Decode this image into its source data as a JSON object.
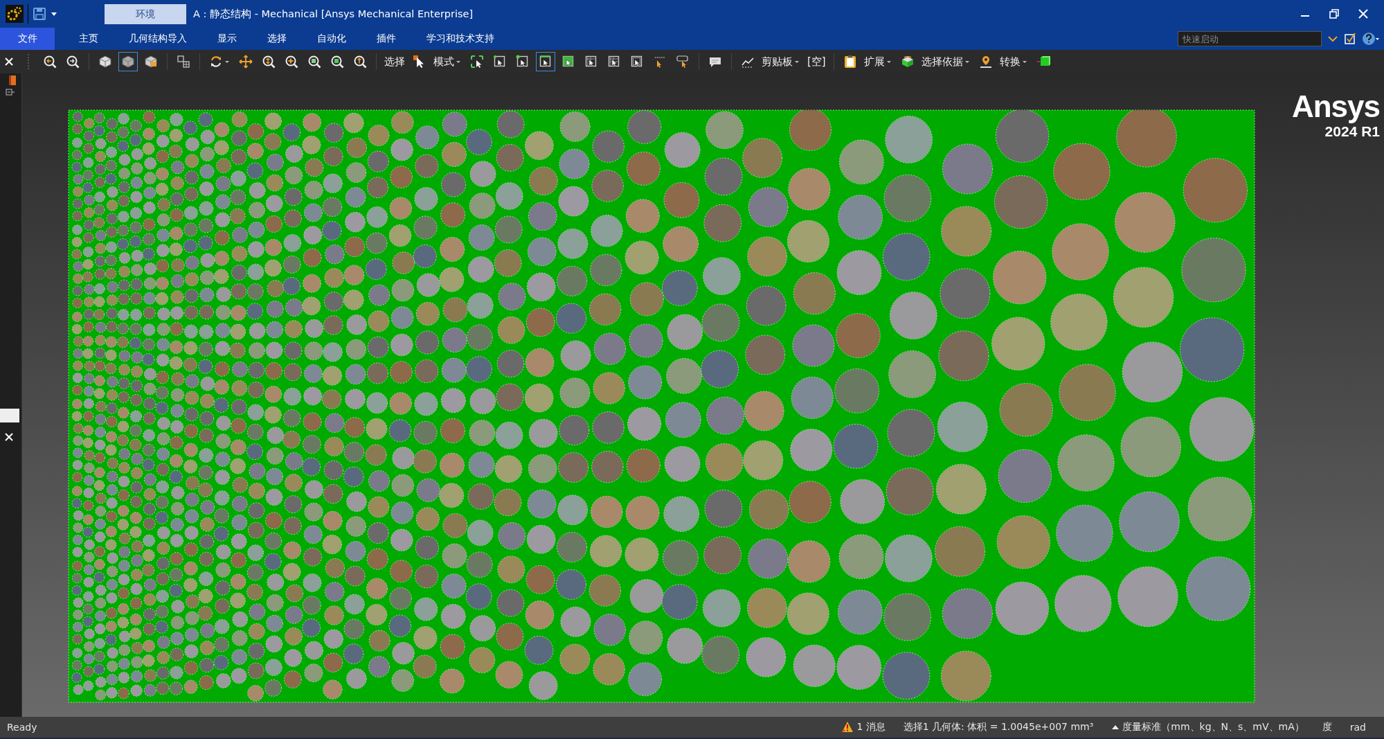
{
  "window": {
    "tab": "环境",
    "title": "A : 静态结构 - Mechanical [Ansys Mechanical Enterprise]"
  },
  "menu": [
    {
      "label": "文件",
      "selected": true
    },
    {
      "label": "主页",
      "selected": false
    },
    {
      "label": "几何结构导入",
      "selected": false
    },
    {
      "label": "显示",
      "selected": false
    },
    {
      "label": "选择",
      "selected": false
    },
    {
      "label": "自动化",
      "selected": false
    },
    {
      "label": "插件",
      "selected": false
    },
    {
      "label": "学习和技术支持",
      "selected": false
    }
  ],
  "quick_launch": {
    "placeholder": "快速启动"
  },
  "toolbar": [
    {
      "kind": "icon",
      "selected": false
    },
    {
      "kind": "icon",
      "selected": false
    },
    {
      "kind": "separator"
    },
    {
      "kind": "icon",
      "selected": false
    },
    {
      "kind": "icon",
      "selected": true
    },
    {
      "kind": "icon",
      "selected": false
    },
    {
      "kind": "separator"
    },
    {
      "kind": "icon",
      "selected": false
    },
    {
      "kind": "separator"
    },
    {
      "kind": "icon",
      "selected": false,
      "dropdown": true
    },
    {
      "kind": "icon",
      "selected": false
    },
    {
      "kind": "icon",
      "selected": false
    },
    {
      "kind": "icon",
      "selected": false
    },
    {
      "kind": "icon",
      "selected": false
    },
    {
      "kind": "icon",
      "selected": false
    },
    {
      "kind": "icon",
      "selected": false
    },
    {
      "kind": "separator"
    },
    {
      "kind": "text",
      "label": "选择"
    },
    {
      "kind": "icon",
      "selected": false
    },
    {
      "kind": "menu",
      "label": "模式"
    },
    {
      "kind": "icon",
      "selected": false
    },
    {
      "kind": "icon",
      "selected": false
    },
    {
      "kind": "icon",
      "selected": false
    },
    {
      "kind": "icon",
      "selected": true
    },
    {
      "kind": "icon",
      "selected": false
    },
    {
      "kind": "icon",
      "selected": false
    },
    {
      "kind": "icon",
      "selected": false
    },
    {
      "kind": "icon",
      "selected": false
    },
    {
      "kind": "icon",
      "selected": false
    },
    {
      "kind": "icon",
      "selected": false
    },
    {
      "kind": "separator"
    },
    {
      "kind": "icon",
      "selected": false
    },
    {
      "kind": "separator"
    },
    {
      "kind": "icon",
      "selected": false
    },
    {
      "kind": "menu",
      "label": "剪贴板"
    },
    {
      "kind": "text",
      "label": "[空]"
    },
    {
      "kind": "separator"
    },
    {
      "kind": "icon",
      "selected": false
    },
    {
      "kind": "menu",
      "label": "扩展"
    },
    {
      "kind": "icon",
      "selected": false
    },
    {
      "kind": "menu",
      "label": "选择依据"
    },
    {
      "kind": "icon",
      "selected": false
    },
    {
      "kind": "menu",
      "label": "转换"
    },
    {
      "kind": "icon",
      "selected": false
    }
  ],
  "viewport": {
    "logo": "Ansys",
    "version": "2024 R1"
  },
  "status_bar": {
    "text": "Ready",
    "items": [
      {
        "kind": "message",
        "label": "1 消息"
      },
      {
        "kind": "text",
        "label": "选择1 几何体: 体积 = 1.0045e+007 mm³"
      },
      {
        "kind": "units",
        "label": "度量标准（mm、kg、N、s、mV、mA）"
      },
      {
        "kind": "text",
        "label": "度"
      },
      {
        "kind": "text",
        "label": "rad"
      }
    ]
  }
}
